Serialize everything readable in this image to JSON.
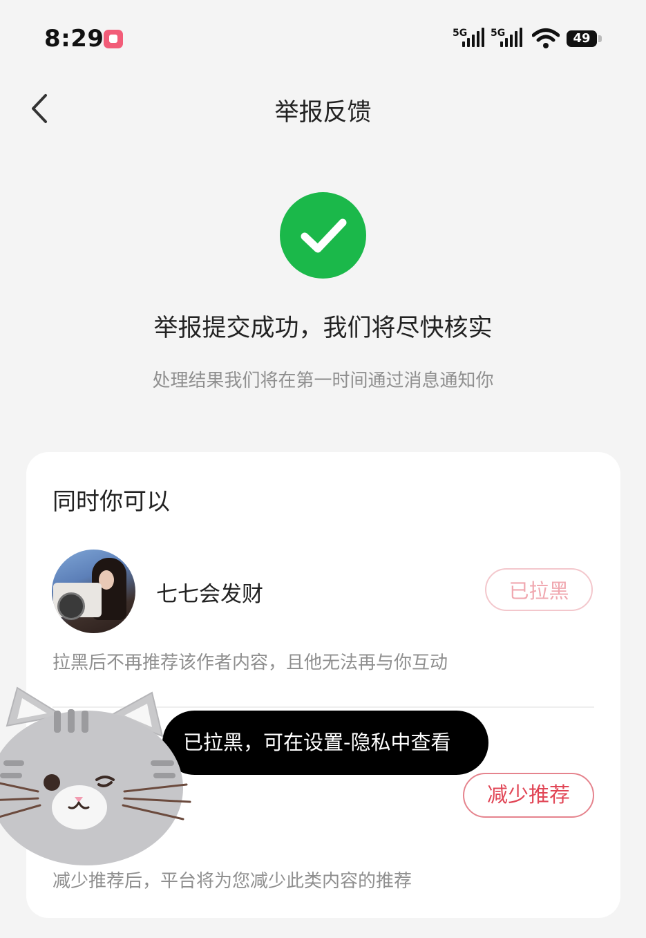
{
  "status_bar": {
    "time": "8:29",
    "signal_1_label": "5G",
    "signal_2_label": "5G",
    "battery": "49",
    "icons": [
      "app-notification-icon",
      "signal-icon",
      "wifi-icon",
      "battery-icon"
    ]
  },
  "header": {
    "title": "举报反馈",
    "back_icon": "chevron-left-icon"
  },
  "result": {
    "icon": "check-circle-icon",
    "title": "举报提交成功，我们将尽快核实",
    "subtitle": "处理结果我们将在第一时间通过消息通知你"
  },
  "card": {
    "title": "同时你可以",
    "author": {
      "name": "七七会发财",
      "button_label": "已拉黑",
      "description": "拉黑后不再推荐该作者内容，且他无法再与你互动"
    },
    "reduce": {
      "button_label": "减少推荐",
      "description": "减少推荐后，平台将为您减少此类内容的推荐"
    }
  },
  "toast": {
    "text": "已拉黑，可在设置-隐私中查看"
  },
  "colors": {
    "success_green": "#1bb84a",
    "accent_red": "#e14656",
    "disabled_pink": "#f0a8b0",
    "background": "#f4f4f4"
  }
}
